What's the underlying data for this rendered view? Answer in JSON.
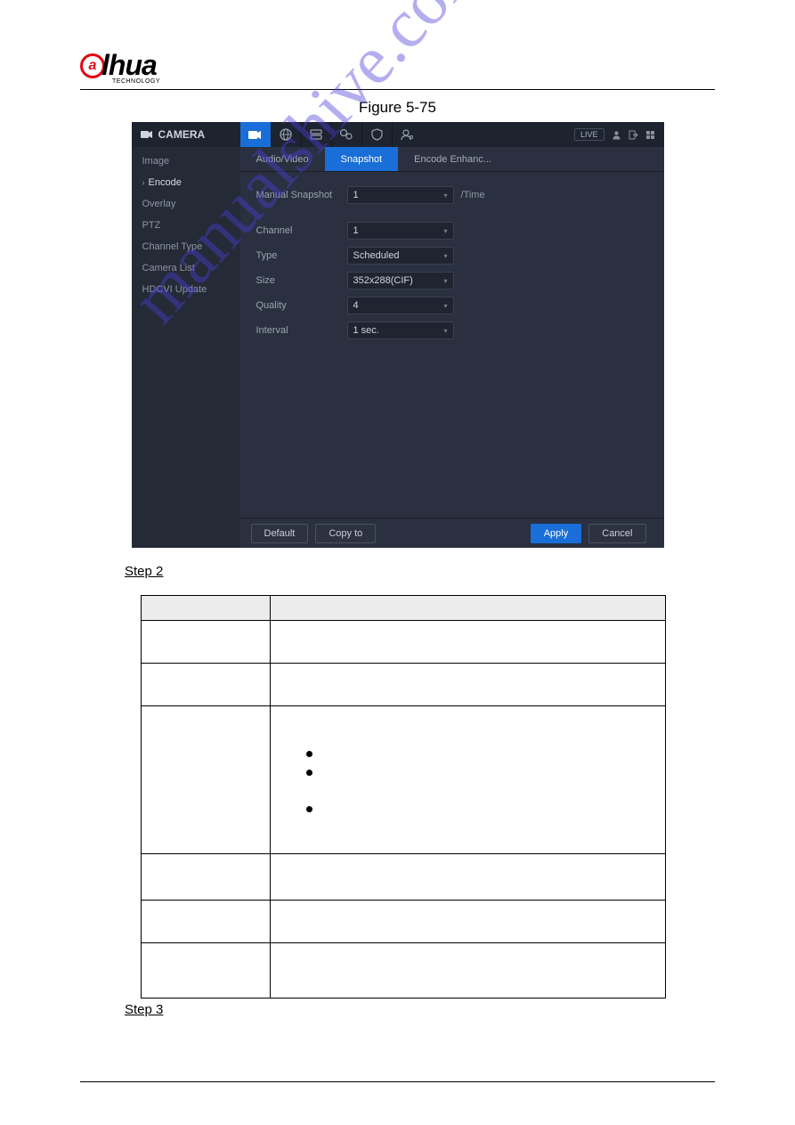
{
  "logo_text": "lhua",
  "logo_sub": "TECHNOLOGY",
  "figure_caption": "Figure 5-75",
  "app": {
    "title": "CAMERA",
    "nav": [
      "camera-icon",
      "globe-icon",
      "storage-icon",
      "gear-icon",
      "shield-icon",
      "user-icon"
    ],
    "top_right": {
      "live": "LIVE"
    },
    "sidebar": [
      {
        "label": "Image"
      },
      {
        "label": "Encode",
        "selected": true
      },
      {
        "label": "Overlay"
      },
      {
        "label": "PTZ"
      },
      {
        "label": "Channel Type"
      },
      {
        "label": "Camera List"
      },
      {
        "label": "HDCVI Update"
      }
    ],
    "tabs": [
      {
        "label": "Audio/Video"
      },
      {
        "label": "Snapshot",
        "active": true
      },
      {
        "label": "Encode Enhanc..."
      }
    ],
    "form": {
      "manual_snapshot": {
        "label": "Manual Snapshot",
        "value": "1",
        "suffix": "/Time"
      },
      "channel": {
        "label": "Channel",
        "value": "1"
      },
      "type": {
        "label": "Type",
        "value": "Scheduled"
      },
      "size": {
        "label": "Size",
        "value": "352x288(CIF)"
      },
      "quality": {
        "label": "Quality",
        "value": "4"
      },
      "interval": {
        "label": "Interval",
        "value": "1 sec."
      }
    },
    "buttons": {
      "default": "Default",
      "copy_to": "Copy to",
      "apply": "Apply",
      "cancel": "Cancel"
    }
  },
  "step2": "Step 2",
  "step3": "Step 3",
  "watermark": "manualshive.com"
}
